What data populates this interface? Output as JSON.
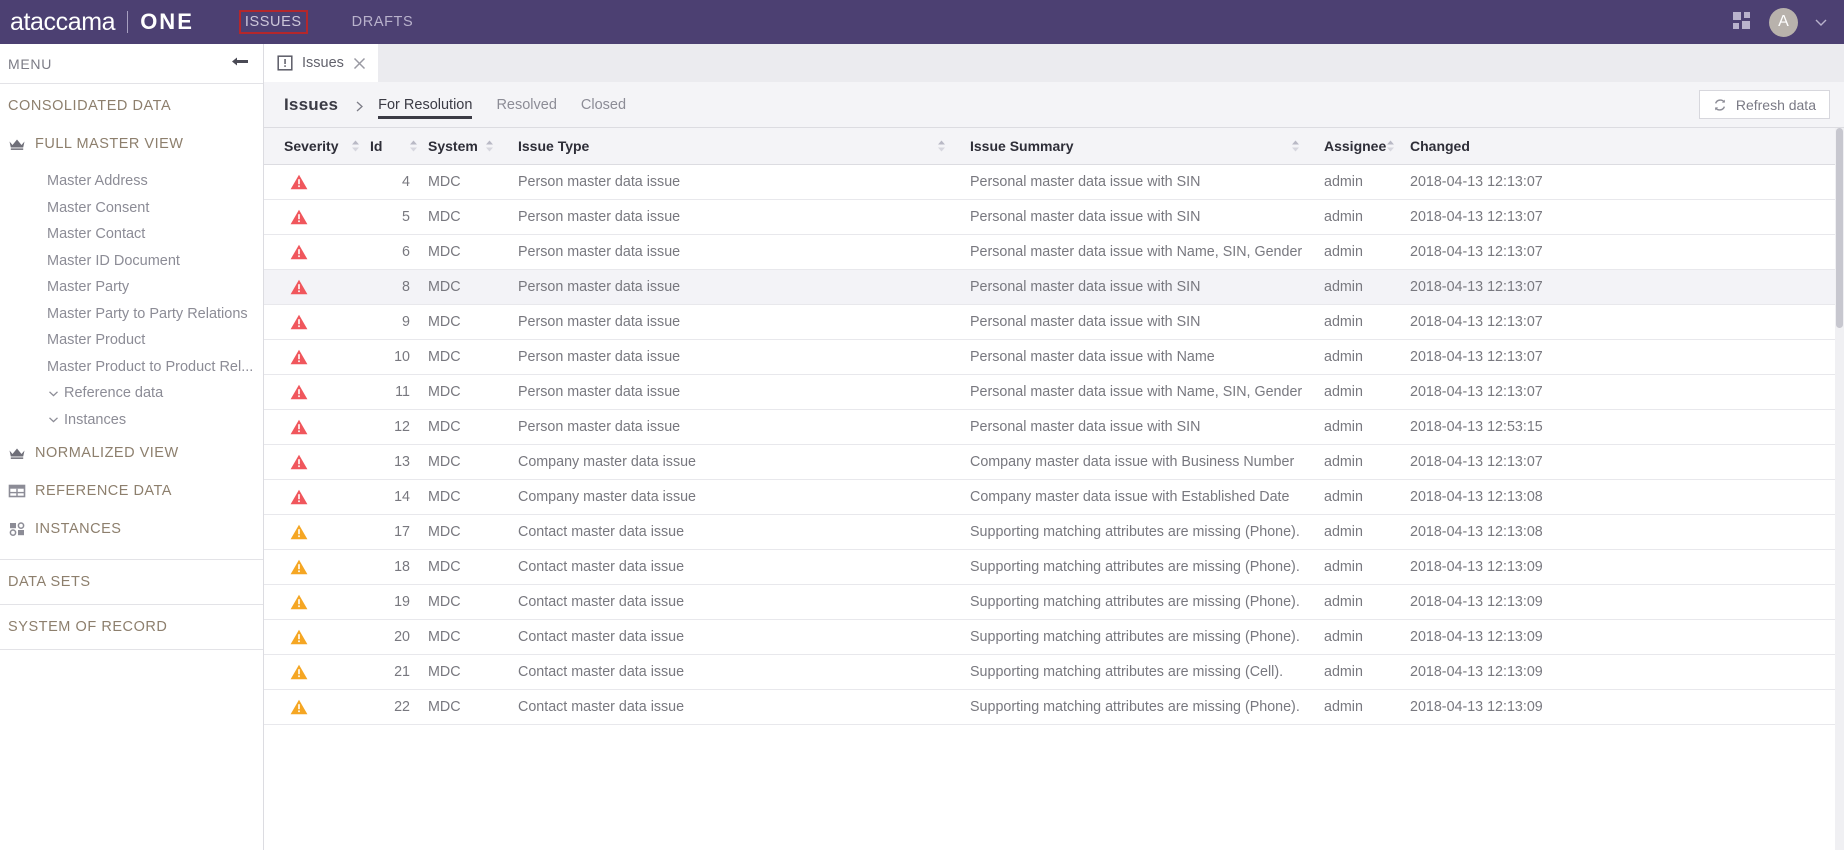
{
  "topbar": {
    "brand_main": "ataccama",
    "brand_sub": "ONE",
    "nav": [
      {
        "label": "ISSUES",
        "highlighted": true
      },
      {
        "label": "DRAFTS",
        "highlighted": false
      }
    ],
    "apps_icon": "apps-grid-icon",
    "avatar_initial": "A",
    "chevron_icon": "chevron-down-icon",
    "background_color": "#4c4072",
    "highlight_outline_color": "#b4272c"
  },
  "sidebar": {
    "menu_label": "MENU",
    "collapse_icon": "collapse-panel-icon",
    "sections": [
      {
        "title": "CONSOLIDATED DATA",
        "groups": [
          {
            "label": "FULL MASTER VIEW",
            "icon": "crown-icon",
            "items": [
              "Master Address",
              "Master Consent",
              "Master Contact",
              "Master ID Document",
              "Master Party",
              "Master Party to Party Relations",
              "Master Product",
              "Master Product to Product Rel..."
            ],
            "subgroups": [
              {
                "label": "Reference data",
                "icon": "chevron-down-icon"
              },
              {
                "label": "Instances",
                "icon": "chevron-down-icon"
              }
            ]
          },
          {
            "label": "NORMALIZED VIEW",
            "icon": "crown-icon",
            "items": [],
            "subgroups": []
          },
          {
            "label": "REFERENCE DATA",
            "icon": "table-icon",
            "items": [],
            "subgroups": []
          },
          {
            "label": "INSTANCES",
            "icon": "instances-icon",
            "items": [],
            "subgroups": []
          }
        ]
      },
      {
        "title": "DATA SETS",
        "groups": []
      },
      {
        "title": "SYSTEM OF RECORD",
        "groups": []
      }
    ]
  },
  "tabstrip": {
    "tabs": [
      {
        "label": "Issues",
        "icon": "issue-alert-icon",
        "close_icon": "close-icon",
        "active": true
      }
    ]
  },
  "subheader": {
    "title": "Issues",
    "breadcrumb_icon": "chevron-right-icon",
    "tabs": [
      {
        "label": "For Resolution",
        "active": true
      },
      {
        "label": "Resolved",
        "active": false
      },
      {
        "label": "Closed",
        "active": false
      }
    ],
    "refresh": {
      "label": "Refresh data",
      "icon": "refresh-icon"
    }
  },
  "table": {
    "columns": [
      {
        "key": "severity",
        "label": "Severity",
        "sortable": true
      },
      {
        "key": "id",
        "label": "Id",
        "sortable": true
      },
      {
        "key": "system",
        "label": "System",
        "sortable": true
      },
      {
        "key": "issue_type",
        "label": "Issue Type",
        "sortable": true
      },
      {
        "key": "issue_summary",
        "label": "Issue Summary",
        "sortable": true
      },
      {
        "key": "assignee",
        "label": "Assignee",
        "sortable": true
      },
      {
        "key": "changed",
        "label": "Changed",
        "sortable": false
      }
    ],
    "severity_colors": {
      "high": "#f0565c",
      "medium": "#f5a623"
    },
    "rows": [
      {
        "severity": "high",
        "id": "4",
        "system": "MDC",
        "issue_type": "Person master data issue",
        "issue_summary": "Personal master data issue with SIN",
        "assignee": "admin",
        "changed": "2018-04-13 12:13:07",
        "hovered": false
      },
      {
        "severity": "high",
        "id": "5",
        "system": "MDC",
        "issue_type": "Person master data issue",
        "issue_summary": "Personal master data issue with SIN",
        "assignee": "admin",
        "changed": "2018-04-13 12:13:07",
        "hovered": false
      },
      {
        "severity": "high",
        "id": "6",
        "system": "MDC",
        "issue_type": "Person master data issue",
        "issue_summary": "Personal master data issue with Name, SIN, Gender",
        "assignee": "admin",
        "changed": "2018-04-13 12:13:07",
        "hovered": false
      },
      {
        "severity": "high",
        "id": "8",
        "system": "MDC",
        "issue_type": "Person master data issue",
        "issue_summary": "Personal master data issue with SIN",
        "assignee": "admin",
        "changed": "2018-04-13 12:13:07",
        "hovered": true
      },
      {
        "severity": "high",
        "id": "9",
        "system": "MDC",
        "issue_type": "Person master data issue",
        "issue_summary": "Personal master data issue with SIN",
        "assignee": "admin",
        "changed": "2018-04-13 12:13:07",
        "hovered": false
      },
      {
        "severity": "high",
        "id": "10",
        "system": "MDC",
        "issue_type": "Person master data issue",
        "issue_summary": "Personal master data issue with Name",
        "assignee": "admin",
        "changed": "2018-04-13 12:13:07",
        "hovered": false
      },
      {
        "severity": "high",
        "id": "11",
        "system": "MDC",
        "issue_type": "Person master data issue",
        "issue_summary": "Personal master data issue with Name, SIN, Gender",
        "assignee": "admin",
        "changed": "2018-04-13 12:13:07",
        "hovered": false
      },
      {
        "severity": "high",
        "id": "12",
        "system": "MDC",
        "issue_type": "Person master data issue",
        "issue_summary": "Personal master data issue with SIN",
        "assignee": "admin",
        "changed": "2018-04-13 12:53:15",
        "hovered": false
      },
      {
        "severity": "high",
        "id": "13",
        "system": "MDC",
        "issue_type": "Company master data issue",
        "issue_summary": "Company master data issue with Business Number",
        "assignee": "admin",
        "changed": "2018-04-13 12:13:07",
        "hovered": false
      },
      {
        "severity": "high",
        "id": "14",
        "system": "MDC",
        "issue_type": "Company master data issue",
        "issue_summary": "Company master data issue with Established Date",
        "assignee": "admin",
        "changed": "2018-04-13 12:13:08",
        "hovered": false
      },
      {
        "severity": "medium",
        "id": "17",
        "system": "MDC",
        "issue_type": "Contact master data issue",
        "issue_summary": "Supporting matching attributes are missing (Phone).",
        "assignee": "admin",
        "changed": "2018-04-13 12:13:08",
        "hovered": false
      },
      {
        "severity": "medium",
        "id": "18",
        "system": "MDC",
        "issue_type": "Contact master data issue",
        "issue_summary": "Supporting matching attributes are missing (Phone).",
        "assignee": "admin",
        "changed": "2018-04-13 12:13:09",
        "hovered": false
      },
      {
        "severity": "medium",
        "id": "19",
        "system": "MDC",
        "issue_type": "Contact master data issue",
        "issue_summary": "Supporting matching attributes are missing (Phone).",
        "assignee": "admin",
        "changed": "2018-04-13 12:13:09",
        "hovered": false
      },
      {
        "severity": "medium",
        "id": "20",
        "system": "MDC",
        "issue_type": "Contact master data issue",
        "issue_summary": "Supporting matching attributes are missing (Phone).",
        "assignee": "admin",
        "changed": "2018-04-13 12:13:09",
        "hovered": false
      },
      {
        "severity": "medium",
        "id": "21",
        "system": "MDC",
        "issue_type": "Contact master data issue",
        "issue_summary": "Supporting matching attributes are missing (Cell).",
        "assignee": "admin",
        "changed": "2018-04-13 12:13:09",
        "hovered": false
      },
      {
        "severity": "medium",
        "id": "22",
        "system": "MDC",
        "issue_type": "Contact master data issue",
        "issue_summary": "Supporting matching attributes are missing (Phone).",
        "assignee": "admin",
        "changed": "2018-04-13 12:13:09",
        "hovered": false
      }
    ]
  }
}
